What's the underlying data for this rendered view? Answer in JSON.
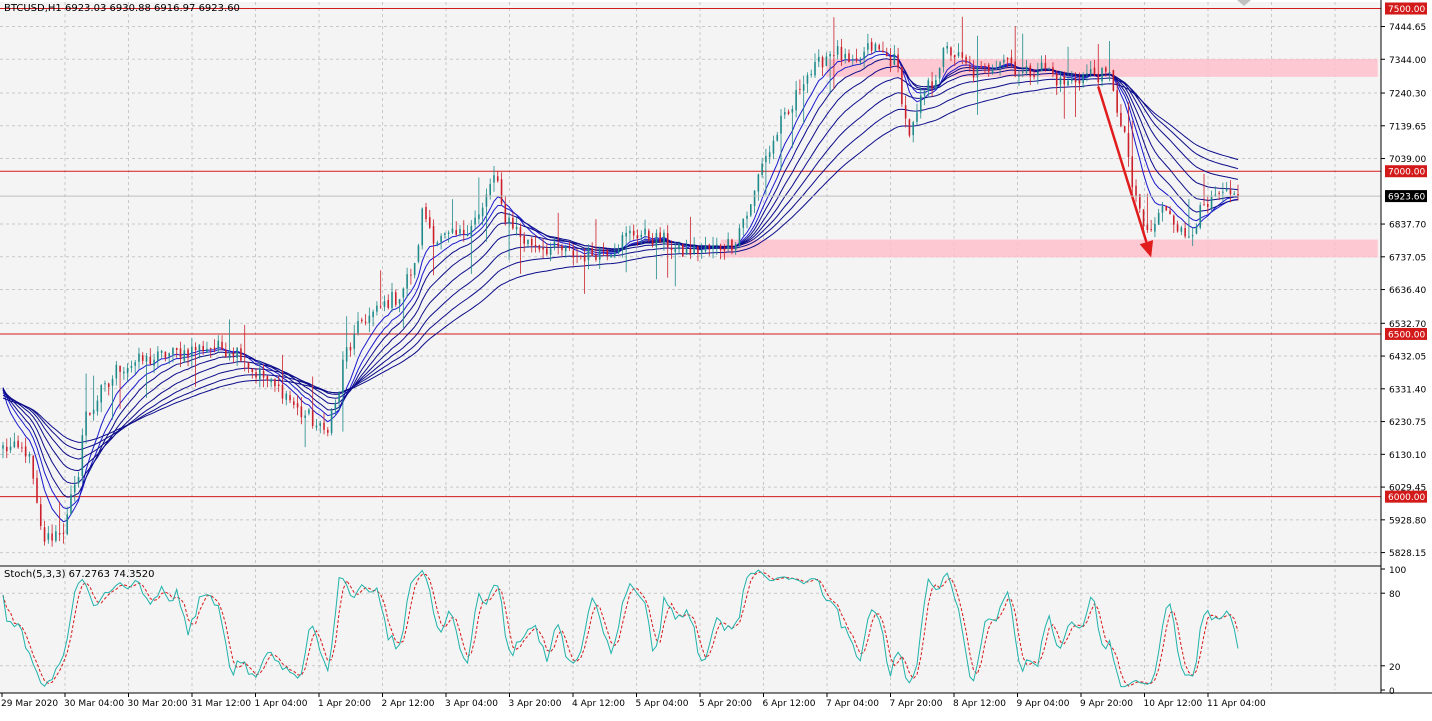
{
  "header": {
    "symbol_line": "BTCUSD,H1  6923.03 6930.88 6916.97 6923.60"
  },
  "stoch_header": "Stoch(5,3,3) 67.2763 74.3520",
  "chart_data": [
    {
      "type": "candlestick",
      "title": "BTCUSD,H1",
      "ylim": [
        5790,
        7520
      ],
      "grid": true,
      "colors": {
        "bull_candle": "#1f8a8a",
        "bear_candle": "#cc1f2a",
        "ribbon": "#0c0c8a",
        "level_line": "#d31a1a",
        "zone_fill": "#ffc0cb",
        "arrow": "#e01c1c",
        "background": "#f4f4f4",
        "grid": "#c8c8c8"
      },
      "y_ticks": [
        "7444.65",
        "7344.00",
        "7240.30",
        "7139.65",
        "7039.00",
        "6837.70",
        "6737.05",
        "6636.40",
        "6532.70",
        "6432.05",
        "6331.40",
        "6230.75",
        "6130.10",
        "6029.45",
        "5928.80",
        "5828.15"
      ],
      "x_ticks": [
        "29 Mar 2020",
        "30 Mar 04:00",
        "30 Mar 20:00",
        "31 Mar 12:00",
        "1 Apr 04:00",
        "1 Apr 20:00",
        "2 Apr 12:00",
        "3 Apr 04:00",
        "3 Apr 20:00",
        "4 Apr 12:00",
        "5 Apr 04:00",
        "5 Apr 20:00",
        "6 Apr 12:00",
        "7 Apr 04:00",
        "7 Apr 20:00",
        "8 Apr 12:00",
        "9 Apr 04:00",
        "9 Apr 20:00",
        "10 Apr 12:00",
        "11 Apr 04:00"
      ],
      "levels": [
        {
          "price": 7500,
          "label": "7500.00"
        },
        {
          "price": 7000,
          "label": "7000.00"
        },
        {
          "price": 6500,
          "label": "6500.00"
        },
        {
          "price": 6000,
          "label": "6000.00"
        }
      ],
      "current_price": {
        "price": 6923.6,
        "label": "6923.60"
      },
      "zones": [
        {
          "from_bar": 218,
          "to_bar": 364,
          "low": 7290,
          "high": 7345
        },
        {
          "from_bar": 190,
          "to_bar": 364,
          "low": 6735,
          "high": 6790
        }
      ],
      "arrow": {
        "from_bar": 290,
        "from_price": 7260,
        "to_bar": 304,
        "to_price": 6735
      },
      "bars": 328,
      "series": [
        {
          "name": "price",
          "anchors": [
            [
              0,
              6150
            ],
            [
              6,
              6140
            ],
            [
              11,
              5870
            ],
            [
              16,
              5900
            ],
            [
              19,
              6020
            ],
            [
              22,
              6250
            ],
            [
              27,
              6330
            ],
            [
              31,
              6400
            ],
            [
              38,
              6420
            ],
            [
              45,
              6440
            ],
            [
              54,
              6460
            ],
            [
              62,
              6450
            ],
            [
              67,
              6380
            ],
            [
              73,
              6330
            ],
            [
              80,
              6250
            ],
            [
              85,
              6200
            ],
            [
              88,
              6280
            ],
            [
              91,
              6450
            ],
            [
              96,
              6550
            ],
            [
              104,
              6610
            ],
            [
              109,
              6700
            ],
            [
              111,
              6870
            ],
            [
              115,
              6790
            ],
            [
              120,
              6800
            ],
            [
              126,
              6860
            ],
            [
              130,
              6980
            ],
            [
              133,
              6860
            ],
            [
              139,
              6780
            ],
            [
              146,
              6760
            ],
            [
              153,
              6740
            ],
            [
              160,
              6760
            ],
            [
              167,
              6810
            ],
            [
              174,
              6790
            ],
            [
              180,
              6750
            ],
            [
              187,
              6760
            ],
            [
              193,
              6780
            ],
            [
              197,
              6870
            ],
            [
              202,
              7050
            ],
            [
              207,
              7160
            ],
            [
              213,
              7300
            ],
            [
              220,
              7370
            ],
            [
              225,
              7320
            ],
            [
              230,
              7380
            ],
            [
              236,
              7340
            ],
            [
              240,
              7120
            ],
            [
              245,
              7260
            ],
            [
              250,
              7370
            ],
            [
              258,
              7300
            ],
            [
              265,
              7350
            ],
            [
              270,
              7300
            ],
            [
              275,
              7320
            ],
            [
              281,
              7270
            ],
            [
              288,
              7300
            ],
            [
              293,
              7290
            ],
            [
              297,
              7100
            ],
            [
              300,
              6900
            ],
            [
              303,
              6810
            ],
            [
              308,
              6890
            ],
            [
              313,
              6800
            ],
            [
              318,
              6880
            ],
            [
              322,
              6920
            ],
            [
              327,
              6923
            ]
          ]
        },
        {
          "name": "ribbon",
          "ema_periods": [
            8,
            12,
            16,
            22,
            30,
            40,
            52,
            66
          ]
        }
      ]
    },
    {
      "type": "line",
      "title": "Stoch(5,3,3)",
      "ylim": [
        0,
        100
      ],
      "y_ticks": [
        "100",
        "80",
        "20",
        "0"
      ],
      "series": [
        {
          "name": "main",
          "current": 67.2763
        },
        {
          "name": "signal",
          "current": 74.352
        }
      ],
      "colors": {
        "main": "#20b2aa",
        "signal": "#d61a1a"
      }
    }
  ]
}
